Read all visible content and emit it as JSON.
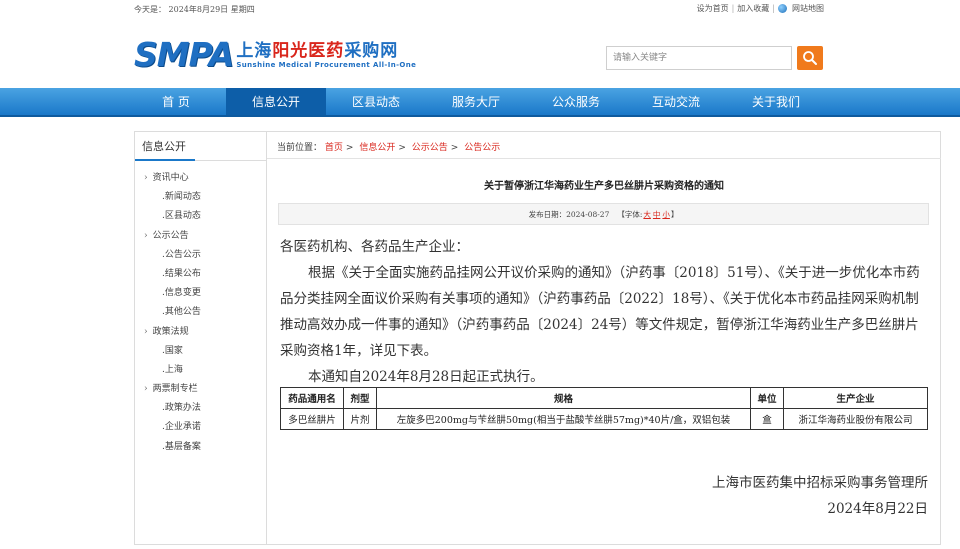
{
  "topbar": {
    "today": "今天是：  2024年8月29日 星期四",
    "set_home": "设为首页",
    "add_fav": "加入收藏",
    "sitemap": "网站地图"
  },
  "header": {
    "logo_abbr": "SMPA",
    "logo_cn_1": "上海",
    "logo_cn_2": "阳光医药",
    "logo_cn_3": "采购网",
    "logo_en": "Sunshine Medical Procurement All-In-One",
    "search_placeholder": "请输入关键字",
    "search_icon": "search-icon"
  },
  "nav": {
    "items": [
      "首 页",
      "信息公开",
      "区县动态",
      "服务大厅",
      "公众服务",
      "互动交流",
      "关于我们"
    ],
    "active_index": 1
  },
  "sidebar": {
    "title": "信息公开",
    "items": [
      {
        "label": "资讯中心",
        "level": "group"
      },
      {
        "label": ".新闻动态",
        "level": "sub"
      },
      {
        "label": ".区县动态",
        "level": "sub"
      },
      {
        "label": "公示公告",
        "level": "group"
      },
      {
        "label": ".公告公示",
        "level": "sub"
      },
      {
        "label": ".结果公布",
        "level": "sub"
      },
      {
        "label": ".信息变更",
        "level": "sub"
      },
      {
        "label": ".其他公告",
        "level": "sub"
      },
      {
        "label": "政策法规",
        "level": "group"
      },
      {
        "label": ".国家",
        "level": "sub"
      },
      {
        "label": ".上海",
        "level": "sub"
      },
      {
        "label": "两票制专栏",
        "level": "group"
      },
      {
        "label": ".政策办法",
        "level": "sub"
      },
      {
        "label": ".企业承诺",
        "level": "sub"
      },
      {
        "label": ".基层备案",
        "level": "sub"
      }
    ]
  },
  "breadcrumb": {
    "prefix": "当前位置：",
    "items": [
      "首页",
      "信息公开",
      "公示公告",
      "公告公示"
    ]
  },
  "article": {
    "title": "关于暂停浙江华海药业生产多巴丝肼片采购资格的通知",
    "publish_date": "发布日期：2024-08-27",
    "font_label_open": "【字体:",
    "font_large": "大",
    "font_medium": "中",
    "font_small": "小",
    "font_label_close": "】",
    "salutation": "各医药机构、各药品生产企业：",
    "paragraph1": "根据《关于全面实施药品挂网公开议价采购的通知》（沪药事〔2018〕51号）、《关于进一步优化本市药品分类挂网全面议价采购有关事项的通知》（沪药事药品〔2022〕18号）、《关于优化本市药品挂网采购机制推动高效办成一件事的通知》（沪药事药品〔2024〕24号）等文件规定，暂停浙江华海药业生产多巴丝肼片采购资格1年，详见下表。",
    "paragraph2": "本通知自2024年8月28日起正式执行。",
    "table": {
      "headers": [
        "药品通用名",
        "剂型",
        "规格",
        "单位",
        "生产企业"
      ],
      "rows": [
        [
          "多巴丝肼片",
          "片剂",
          "左旋多巴200mg与苄丝肼50mg(相当于盐酸苄丝肼57mg)*40片/盒，双铝包装",
          "盒",
          "浙江华海药业股份有限公司"
        ]
      ]
    },
    "signer": "上海市医药集中招标采购事务管理所",
    "sign_date": "2024年8月22日"
  },
  "colors": {
    "brand_blue": "#1f6fc2",
    "nav_blue": "#1a78c9",
    "accent_orange": "#f07a1c",
    "link_red": "#d9261c"
  }
}
